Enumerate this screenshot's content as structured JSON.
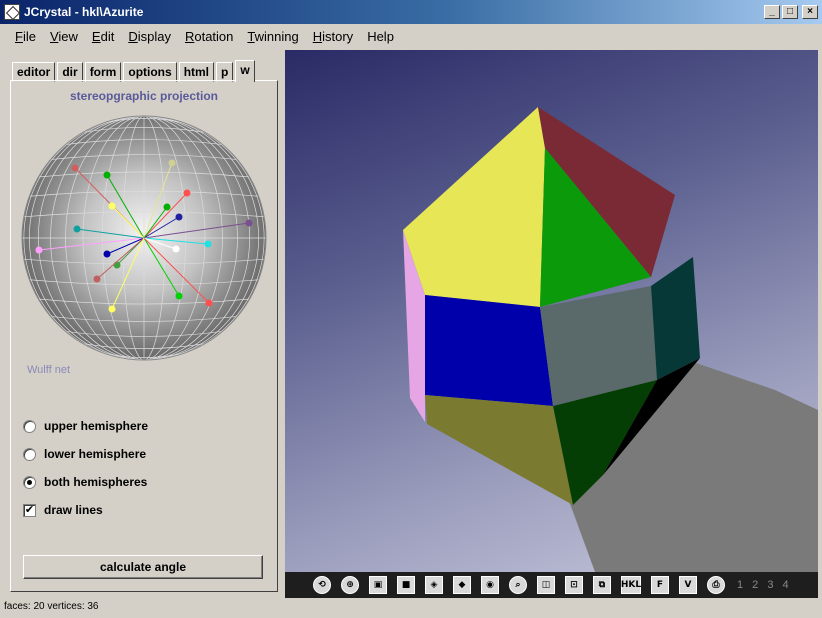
{
  "window": {
    "title": "JCrystal - hkl\\Azurite",
    "minimize": "_",
    "maximize": "□",
    "close": "×"
  },
  "menu": {
    "items": [
      {
        "label": "File",
        "mnemonic": "F",
        "rest": "ile"
      },
      {
        "label": "View",
        "mnemonic": "V",
        "rest": "iew"
      },
      {
        "label": "Edit",
        "mnemonic": "E",
        "rest": "dit"
      },
      {
        "label": "Display",
        "mnemonic": "D",
        "rest": "isplay"
      },
      {
        "label": "Rotation",
        "mnemonic": "R",
        "rest": "otation"
      },
      {
        "label": "Twinning",
        "mnemonic": "T",
        "rest": "winning"
      },
      {
        "label": "History",
        "mnemonic": "H",
        "rest": "istory"
      },
      {
        "label": "Help",
        "mnemonic": "",
        "rest": "Help"
      }
    ]
  },
  "tabs": [
    "editor",
    "dir",
    "form",
    "options",
    "html",
    "p",
    "w"
  ],
  "active_tab": "w",
  "panel": {
    "title": "stereopgraphic projection",
    "wulff_label": "Wulff net",
    "radios": {
      "upper": "upper hemisphere",
      "lower": "lower hemisphere",
      "both": "both hemispheres"
    },
    "selected_radio": "both",
    "draw_lines": "draw lines",
    "draw_lines_checked": true,
    "calculate_button": "calculate angle"
  },
  "toolbar": {
    "hkl_label": "HKL",
    "f_label": "F",
    "v_label": "V",
    "page_numbers": "1 2 3 4"
  },
  "status": {
    "text": "faces: 20  vertices: 36"
  },
  "colors": {
    "face_yellow": "#e6e656",
    "face_red": "#7a2a34",
    "face_green": "#0a9a0a",
    "face_blue": "#0000aa",
    "face_gray": "#5a6a6a",
    "face_teal": "#063838",
    "face_olive": "#7a7a30",
    "face_darkgreen": "#043e04",
    "face_pink": "#e6a6e6",
    "shadow": "#7a7a7a"
  }
}
